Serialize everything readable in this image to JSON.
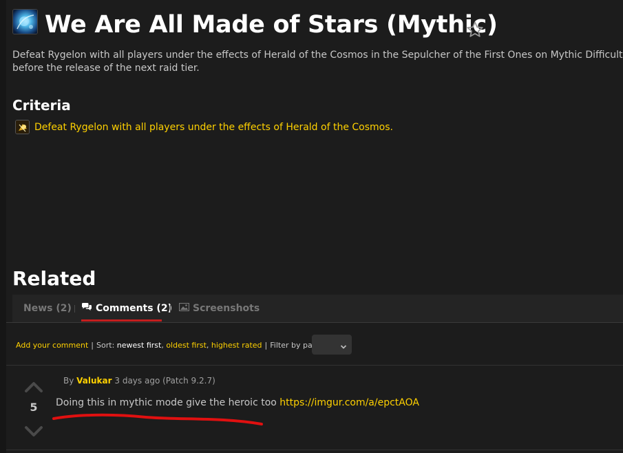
{
  "achievement": {
    "title": "We Are All Made of Stars (Mythic)",
    "icon": "cosmic-achievement-icon",
    "description": "Defeat Rygelon with all players under the effects of Herald of the Cosmos in the Sepulcher of the First Ones on Mythic Difficulty, before the release of the next raid tier."
  },
  "criteria": {
    "heading": "Criteria",
    "items": [
      {
        "label": "Defeat Rygelon with all players under the effects of Herald of the Cosmos.",
        "icon": "boss-criteria-icon"
      }
    ]
  },
  "related": {
    "heading": "Related",
    "tabs": [
      {
        "label": "News (2)",
        "active": false
      },
      {
        "label": "Comments (2)",
        "active": true,
        "icon": "chat-bubbles-icon"
      },
      {
        "label": "Screenshots",
        "active": false,
        "icon": "image-icon"
      }
    ]
  },
  "sortbar": {
    "add_comment": "Add your comment",
    "sort_label": "Sort:",
    "newest": "newest first",
    "oldest": "oldest first",
    "highest": "highest rated",
    "filter_label": "Filter by patch:"
  },
  "comment": {
    "by": "By",
    "author": "Valukar",
    "meta": "3 days ago (Patch 9.2.7)",
    "votes": "5",
    "text": "Doing this in mythic mode give the heroic too",
    "link": "https://imgur.com/a/epctAOA"
  },
  "colors": {
    "background": "#1c1c1c",
    "link": "#ffd100",
    "active_tab_underline": "#c41e1e",
    "annotation": "#e01010"
  }
}
